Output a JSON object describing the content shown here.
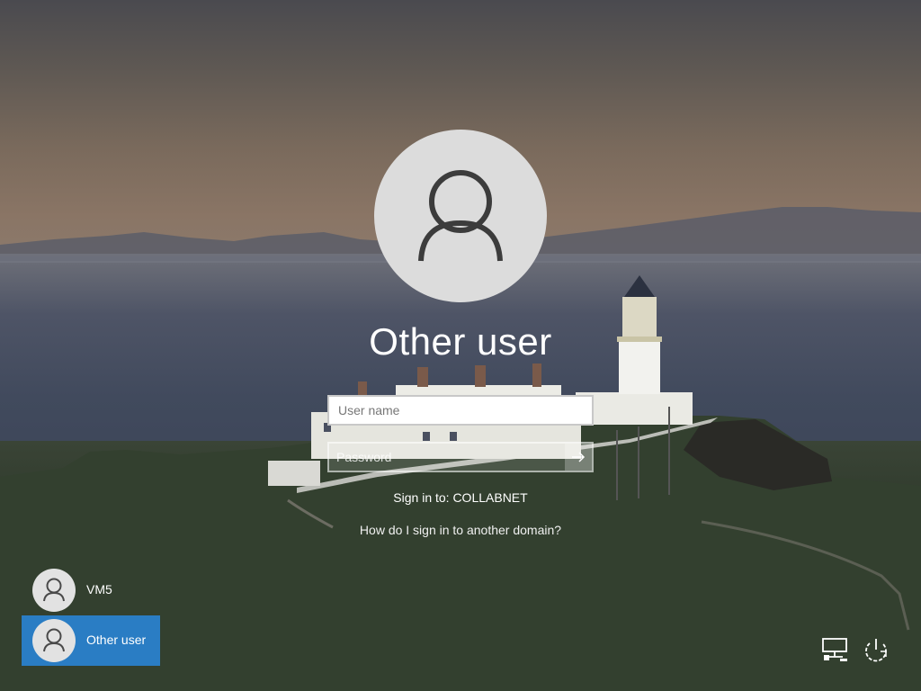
{
  "screen": {
    "user_title": "Other user",
    "username_placeholder": "User name",
    "password_placeholder": "Password",
    "signin_to": "Sign in to: COLLABNET",
    "help_link": "How do I sign in to another domain?"
  },
  "users": [
    {
      "name": "VM5",
      "selected": false
    },
    {
      "name": "Other user",
      "selected": true
    }
  ],
  "icons": {
    "avatar": "user-icon",
    "submit": "arrow-right-icon",
    "network": "network-icon",
    "power": "power-icon"
  },
  "colors": {
    "selected_user": "#2a7dc4",
    "avatar_bg": "#dcdcdc"
  }
}
